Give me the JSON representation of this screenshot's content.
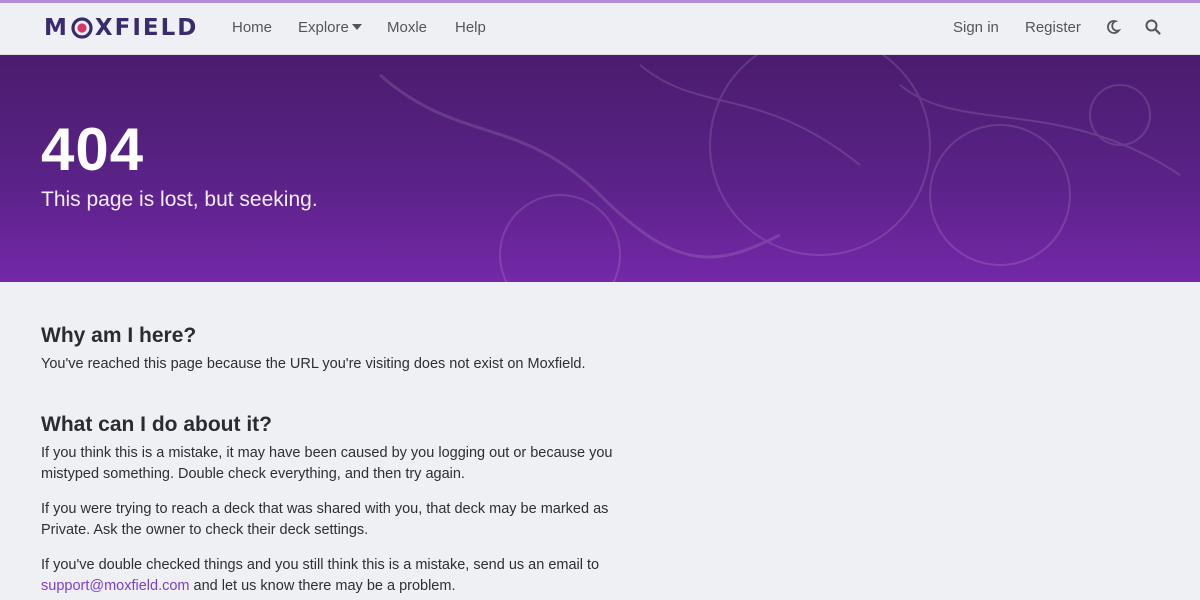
{
  "brand": {
    "logo_text_left": "M",
    "logo_text_right": "XFIELD",
    "accent_color": "#7428a8",
    "logo_mark_color": "#d8356b"
  },
  "nav": {
    "links": [
      "Home",
      "Explore",
      "Moxle",
      "Help"
    ],
    "sign_in": "Sign in",
    "register": "Register",
    "theme_icon": "moon-icon",
    "search_icon": "search-icon"
  },
  "hero": {
    "code": "404",
    "subtitle": "This page is lost, but seeking."
  },
  "content": {
    "section1_title": "Why am I here?",
    "section1_text": "You've reached this page because the URL you're visiting does not exist on Moxfield.",
    "section2_title": "What can I do about it?",
    "para1": "If you think this is a mistake, it may have been caused by you logging out or because you mistyped something. Double check everything, and then try again.",
    "para2": "If you were trying to reach a deck that was shared with you, that deck may be marked as Private. Ask the owner to check their deck settings.",
    "para3_before": "If you've double checked things and you still think this is a mistake, send us an email to ",
    "email": "support@moxfield.com",
    "para3_after": " and let us know there may be a problem."
  }
}
